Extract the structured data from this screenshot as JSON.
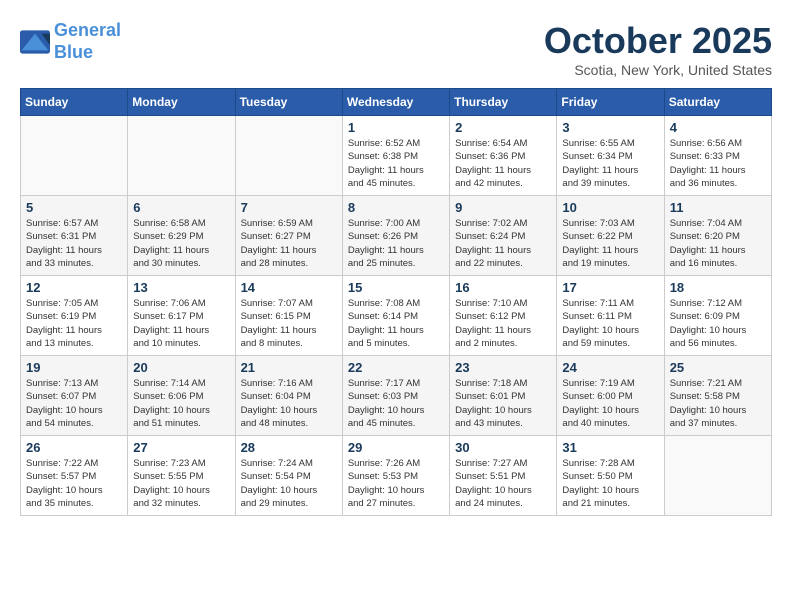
{
  "header": {
    "logo_line1": "General",
    "logo_line2": "Blue",
    "title": "October 2025",
    "subtitle": "Scotia, New York, United States"
  },
  "weekdays": [
    "Sunday",
    "Monday",
    "Tuesday",
    "Wednesday",
    "Thursday",
    "Friday",
    "Saturday"
  ],
  "weeks": [
    [
      {
        "day": "",
        "info": ""
      },
      {
        "day": "",
        "info": ""
      },
      {
        "day": "",
        "info": ""
      },
      {
        "day": "1",
        "info": "Sunrise: 6:52 AM\nSunset: 6:38 PM\nDaylight: 11 hours\nand 45 minutes."
      },
      {
        "day": "2",
        "info": "Sunrise: 6:54 AM\nSunset: 6:36 PM\nDaylight: 11 hours\nand 42 minutes."
      },
      {
        "day": "3",
        "info": "Sunrise: 6:55 AM\nSunset: 6:34 PM\nDaylight: 11 hours\nand 39 minutes."
      },
      {
        "day": "4",
        "info": "Sunrise: 6:56 AM\nSunset: 6:33 PM\nDaylight: 11 hours\nand 36 minutes."
      }
    ],
    [
      {
        "day": "5",
        "info": "Sunrise: 6:57 AM\nSunset: 6:31 PM\nDaylight: 11 hours\nand 33 minutes."
      },
      {
        "day": "6",
        "info": "Sunrise: 6:58 AM\nSunset: 6:29 PM\nDaylight: 11 hours\nand 30 minutes."
      },
      {
        "day": "7",
        "info": "Sunrise: 6:59 AM\nSunset: 6:27 PM\nDaylight: 11 hours\nand 28 minutes."
      },
      {
        "day": "8",
        "info": "Sunrise: 7:00 AM\nSunset: 6:26 PM\nDaylight: 11 hours\nand 25 minutes."
      },
      {
        "day": "9",
        "info": "Sunrise: 7:02 AM\nSunset: 6:24 PM\nDaylight: 11 hours\nand 22 minutes."
      },
      {
        "day": "10",
        "info": "Sunrise: 7:03 AM\nSunset: 6:22 PM\nDaylight: 11 hours\nand 19 minutes."
      },
      {
        "day": "11",
        "info": "Sunrise: 7:04 AM\nSunset: 6:20 PM\nDaylight: 11 hours\nand 16 minutes."
      }
    ],
    [
      {
        "day": "12",
        "info": "Sunrise: 7:05 AM\nSunset: 6:19 PM\nDaylight: 11 hours\nand 13 minutes."
      },
      {
        "day": "13",
        "info": "Sunrise: 7:06 AM\nSunset: 6:17 PM\nDaylight: 11 hours\nand 10 minutes."
      },
      {
        "day": "14",
        "info": "Sunrise: 7:07 AM\nSunset: 6:15 PM\nDaylight: 11 hours\nand 8 minutes."
      },
      {
        "day": "15",
        "info": "Sunrise: 7:08 AM\nSunset: 6:14 PM\nDaylight: 11 hours\nand 5 minutes."
      },
      {
        "day": "16",
        "info": "Sunrise: 7:10 AM\nSunset: 6:12 PM\nDaylight: 11 hours\nand 2 minutes."
      },
      {
        "day": "17",
        "info": "Sunrise: 7:11 AM\nSunset: 6:11 PM\nDaylight: 10 hours\nand 59 minutes."
      },
      {
        "day": "18",
        "info": "Sunrise: 7:12 AM\nSunset: 6:09 PM\nDaylight: 10 hours\nand 56 minutes."
      }
    ],
    [
      {
        "day": "19",
        "info": "Sunrise: 7:13 AM\nSunset: 6:07 PM\nDaylight: 10 hours\nand 54 minutes."
      },
      {
        "day": "20",
        "info": "Sunrise: 7:14 AM\nSunset: 6:06 PM\nDaylight: 10 hours\nand 51 minutes."
      },
      {
        "day": "21",
        "info": "Sunrise: 7:16 AM\nSunset: 6:04 PM\nDaylight: 10 hours\nand 48 minutes."
      },
      {
        "day": "22",
        "info": "Sunrise: 7:17 AM\nSunset: 6:03 PM\nDaylight: 10 hours\nand 45 minutes."
      },
      {
        "day": "23",
        "info": "Sunrise: 7:18 AM\nSunset: 6:01 PM\nDaylight: 10 hours\nand 43 minutes."
      },
      {
        "day": "24",
        "info": "Sunrise: 7:19 AM\nSunset: 6:00 PM\nDaylight: 10 hours\nand 40 minutes."
      },
      {
        "day": "25",
        "info": "Sunrise: 7:21 AM\nSunset: 5:58 PM\nDaylight: 10 hours\nand 37 minutes."
      }
    ],
    [
      {
        "day": "26",
        "info": "Sunrise: 7:22 AM\nSunset: 5:57 PM\nDaylight: 10 hours\nand 35 minutes."
      },
      {
        "day": "27",
        "info": "Sunrise: 7:23 AM\nSunset: 5:55 PM\nDaylight: 10 hours\nand 32 minutes."
      },
      {
        "day": "28",
        "info": "Sunrise: 7:24 AM\nSunset: 5:54 PM\nDaylight: 10 hours\nand 29 minutes."
      },
      {
        "day": "29",
        "info": "Sunrise: 7:26 AM\nSunset: 5:53 PM\nDaylight: 10 hours\nand 27 minutes."
      },
      {
        "day": "30",
        "info": "Sunrise: 7:27 AM\nSunset: 5:51 PM\nDaylight: 10 hours\nand 24 minutes."
      },
      {
        "day": "31",
        "info": "Sunrise: 7:28 AM\nSunset: 5:50 PM\nDaylight: 10 hours\nand 21 minutes."
      },
      {
        "day": "",
        "info": ""
      }
    ]
  ]
}
